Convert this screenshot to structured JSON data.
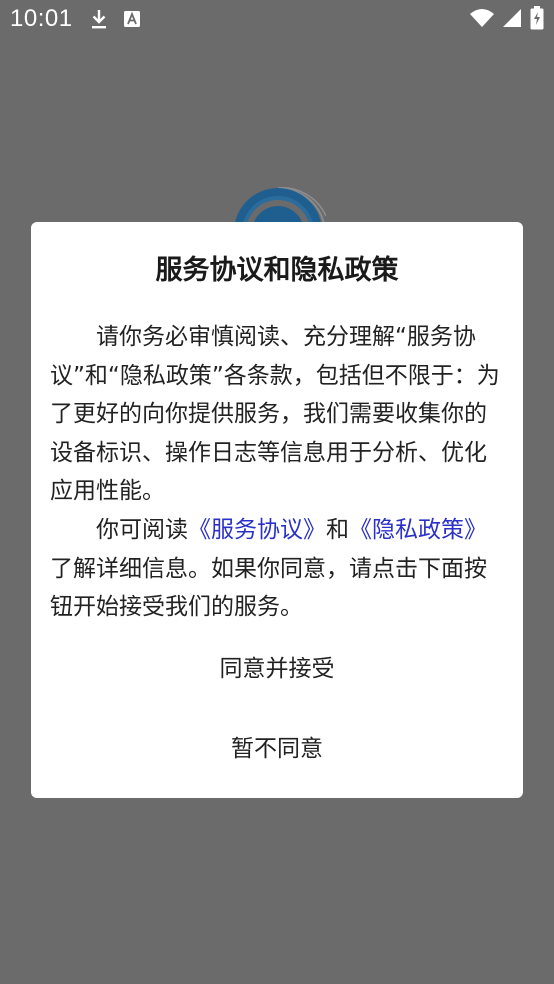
{
  "status_bar": {
    "time": "10:01",
    "icons": [
      "download-icon",
      "font-a-icon",
      "wifi-icon",
      "cell-signal-icon",
      "battery-icon"
    ]
  },
  "dialog": {
    "title": "服务协议和隐私政策",
    "paragraph1": "请你务必审慎阅读、充分理解“服务协议”和“隐私政策”各条款，包括但不限于：为了更好的向你提供服务，我们需要收集你的设备标识、操作日志等信息用于分析、优化应用性能。",
    "paragraph2_prefix": "你可阅读",
    "service_link": "《服务协议》",
    "paragraph2_and": "和",
    "privacy_link": "《隐私政策》",
    "paragraph2_suffix": "了解详细信息。如果你同意，请点击下面按钮开始接受我们的服务。",
    "agree_button": "同意并接受",
    "decline_button": "暂不同意"
  },
  "colors": {
    "scrim": "#6b6b6b",
    "dialog_bg": "#ffffff",
    "link": "#2b31c8",
    "logo_blue": "#1f5f8f"
  }
}
